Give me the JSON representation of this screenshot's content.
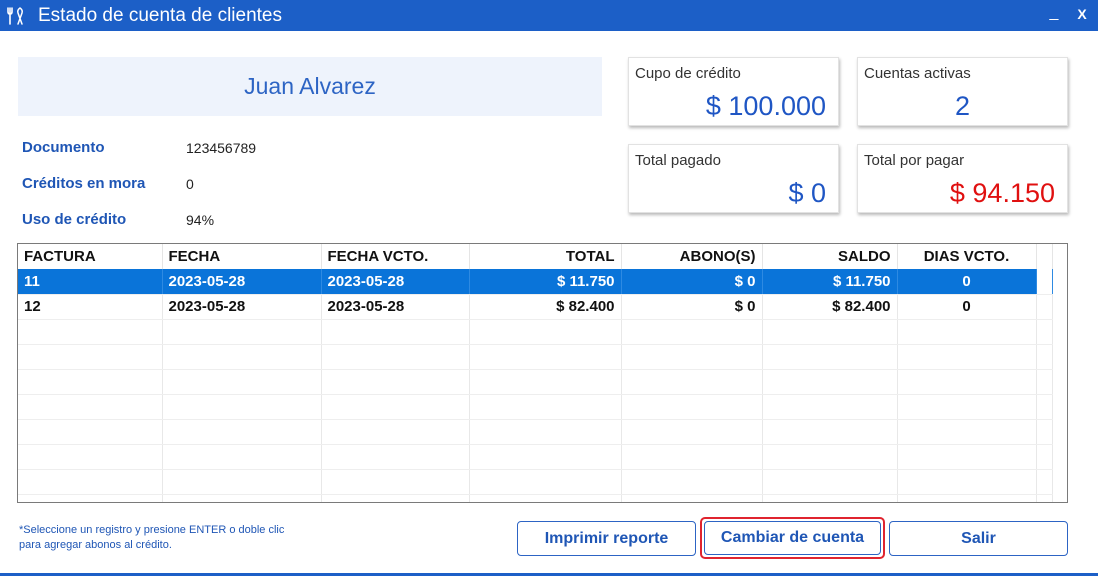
{
  "window": {
    "title": "Estado de cuenta de clientes",
    "minimize_glyph": "_",
    "close_glyph": "X"
  },
  "customer": {
    "name": "Juan Alvarez"
  },
  "info": [
    {
      "label": "Documento",
      "value": "123456789"
    },
    {
      "label": "Créditos en mora",
      "value": "0"
    },
    {
      "label": "Uso de crédito",
      "value": "94%"
    }
  ],
  "cards": {
    "credit_limit": {
      "label": "Cupo de crédito",
      "value": "$ 100.000"
    },
    "active_accounts": {
      "label": "Cuentas activas",
      "value": "2"
    },
    "total_paid": {
      "label": "Total pagado",
      "value": "$ 0"
    },
    "total_due": {
      "label": "Total por pagar",
      "value": "$ 94.150"
    }
  },
  "table": {
    "columns": [
      "FACTURA",
      "FECHA",
      "FECHA VCTO.",
      "TOTAL",
      "ABONO(S)",
      "SALDO",
      "DIAS VCTO."
    ],
    "rows": [
      [
        "11",
        "2023-05-28",
        "2023-05-28",
        "$ 11.750",
        "$ 0",
        "$ 11.750",
        "0"
      ],
      [
        "12",
        "2023-05-28",
        "2023-05-28",
        "$ 82.400",
        "$ 0",
        "$ 82.400",
        "0"
      ]
    ],
    "selected_row": 0
  },
  "hint": {
    "line1": "*Seleccione un registro y presione ENTER  o doble clic",
    "line2": "para agregar abonos al crédito."
  },
  "buttons": {
    "print": "Imprimir reporte",
    "change_account": "Cambiar de cuenta",
    "exit": "Salir"
  },
  "colors": {
    "accent": "#1c5fc7",
    "selection": "#0a74d9",
    "due_red": "#e01010",
    "focus_ring": "#e0242f"
  },
  "icons": {
    "app": "tools-icon"
  }
}
